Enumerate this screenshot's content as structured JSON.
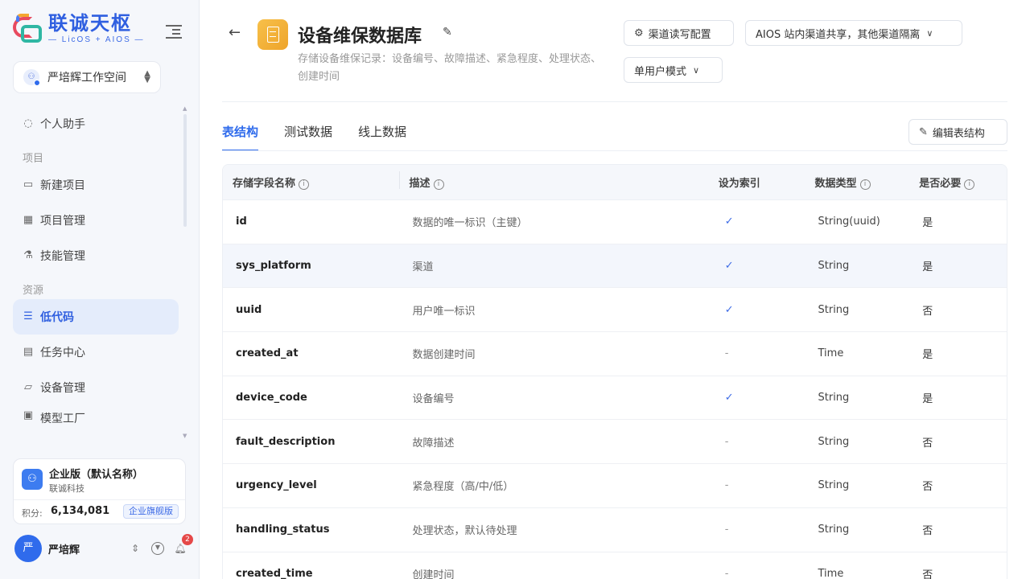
{
  "brand": {
    "title": "联诚天枢",
    "subtitle": "— LicOS + AIOS —"
  },
  "workspace": {
    "name": "严培辉工作空间"
  },
  "nav": {
    "assistant": "个人助手",
    "section_project": "项目",
    "new_project": "新建项目",
    "project_mgmt": "项目管理",
    "skill_mgmt": "技能管理",
    "section_resource": "资源",
    "lowcode": "低代码",
    "task_center": "任务中心",
    "device_mgmt": "设备管理",
    "model_factory": "模型工厂"
  },
  "enterprise": {
    "name": "企业版（默认名称）",
    "company": "联诚科技",
    "points_label": "积分:",
    "points": "6,134,081",
    "badge": "企业旗舰版"
  },
  "user": {
    "avatar": "严",
    "name": "严培辉",
    "notifications": "2"
  },
  "header": {
    "title": "设备维保数据库",
    "description": "存储设备维保记录：设备编号、故障描述、紧急程度、处理状态、创建时间",
    "channel_config": "渠道读写配置",
    "share_mode": "AIOS 站内渠道共享，其他渠道隔离",
    "user_mode": "单用户模式"
  },
  "tabs": {
    "schema": "表结构",
    "test_data": "测试数据",
    "online_data": "线上数据",
    "edit_schema": "编辑表结构"
  },
  "table": {
    "headers": {
      "field": "存储字段名称",
      "desc": "描述",
      "index": "设为索引",
      "type": "数据类型",
      "required": "是否必要"
    },
    "rows": [
      {
        "field": "id",
        "desc": "数据的唯一标识（主键）",
        "index": "✓",
        "type": "String(uuid)",
        "required": "是"
      },
      {
        "field": "sys_platform",
        "desc": "渠道",
        "index": "✓",
        "type": "String",
        "required": "是"
      },
      {
        "field": "uuid",
        "desc": "用户唯一标识",
        "index": "✓",
        "type": "String",
        "required": "否"
      },
      {
        "field": "created_at",
        "desc": "数据创建时间",
        "index": "-",
        "type": "Time",
        "required": "是"
      },
      {
        "field": "device_code",
        "desc": "设备编号",
        "index": "✓",
        "type": "String",
        "required": "是"
      },
      {
        "field": "fault_description",
        "desc": "故障描述",
        "index": "-",
        "type": "String",
        "required": "否"
      },
      {
        "field": "urgency_level",
        "desc": "紧急程度（高/中/低）",
        "index": "-",
        "type": "String",
        "required": "否"
      },
      {
        "field": "handling_status",
        "desc": "处理状态，默认待处理",
        "index": "-",
        "type": "String",
        "required": "否"
      },
      {
        "field": "created_time",
        "desc": "创建时间",
        "index": "-",
        "type": "Time",
        "required": "否"
      }
    ]
  },
  "colors": {
    "accent": "#2f6bec",
    "active_nav_bg": "#e4ecfb",
    "db_icon": "#f4b23a"
  }
}
